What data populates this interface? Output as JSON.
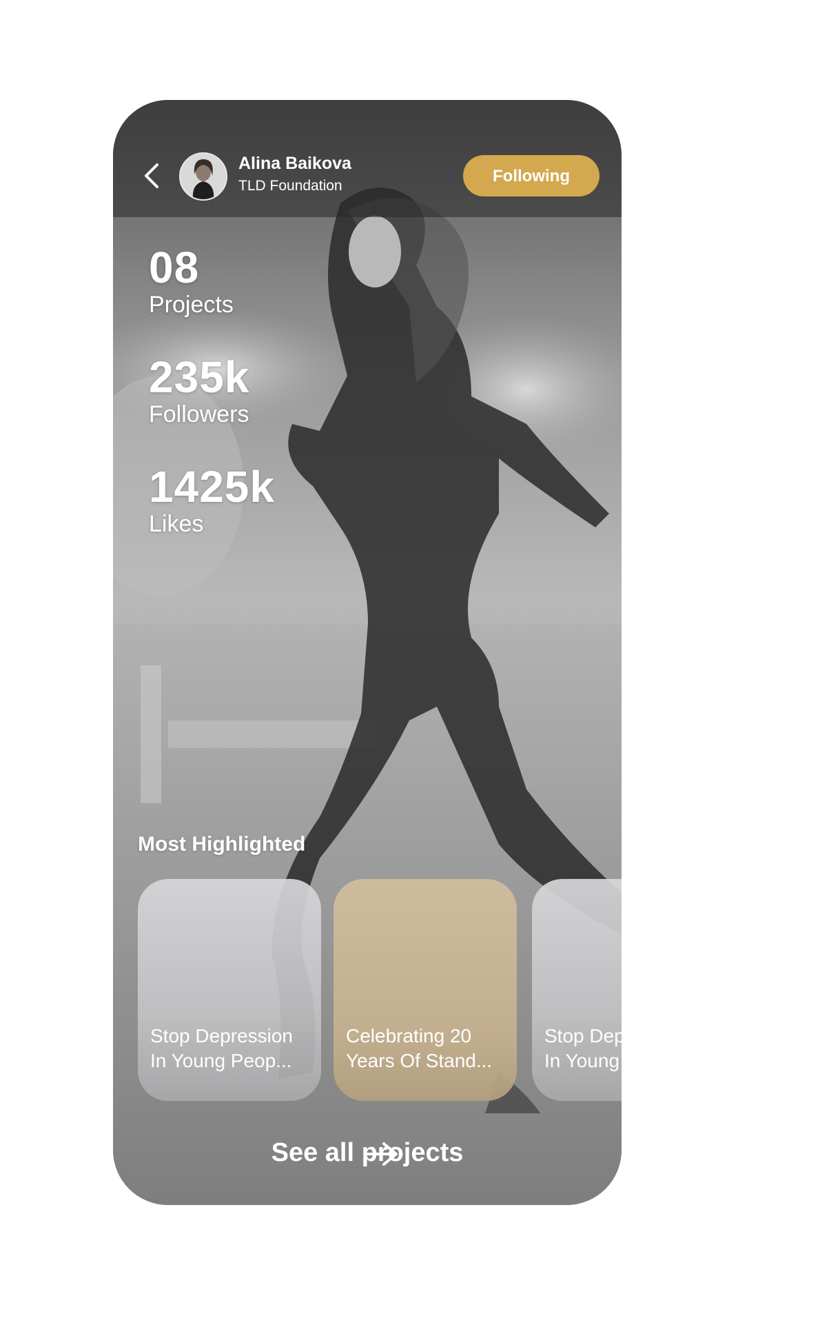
{
  "profile": {
    "name": "Alina Baikova",
    "organization": "TLD Foundation",
    "follow_label": "Following",
    "avatar_icon": "avatar-photo"
  },
  "stats": [
    {
      "value": "08",
      "label": "Projects"
    },
    {
      "value": "235k",
      "label": "Followers"
    },
    {
      "value": "1425k",
      "label": "Likes"
    }
  ],
  "highlighted": {
    "title": "Most Highlighted",
    "cards": [
      {
        "line1": "Stop Depression",
        "line2": "In Young Peop...",
        "style": "grey"
      },
      {
        "line1": "Celebrating 20",
        "line2": "Years Of Stand...",
        "style": "gold"
      },
      {
        "line1": "Stop Depression",
        "line2": "In Young Peop...",
        "style": "grey"
      }
    ]
  },
  "footer": {
    "see_all_label": "See all projects",
    "arrow_icon": "arrow-right-icon"
  },
  "colors": {
    "accent": "#d4a84e",
    "card_gold": "#cdbb9d",
    "text": "#ffffff"
  }
}
